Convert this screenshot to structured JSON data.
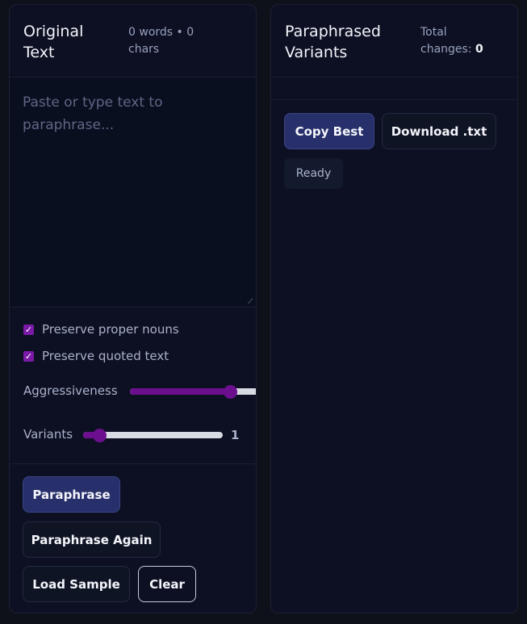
{
  "original": {
    "title": "Original Text",
    "word_count": "0",
    "words_label": "words",
    "separator": "•",
    "char_count": "0",
    "chars_label": "chars",
    "placeholder": "Paste or type text to paraphrase...",
    "preserve_proper_nouns_label": "Preserve proper nouns",
    "preserve_quoted_text_label": "Preserve quoted text",
    "aggressiveness_label": "Aggressiveness",
    "aggressiveness_level": 0.73,
    "variants_label": "Variants",
    "variants_value": "1",
    "variants_level": 0.12,
    "buttons": {
      "paraphrase": "Paraphrase",
      "paraphrase_again": "Paraphrase Again",
      "load_sample": "Load Sample",
      "clear": "Clear"
    }
  },
  "variants": {
    "title": "Paraphrased Variants",
    "total_changes_label": "Total changes:",
    "total_changes_value": "0",
    "copy_best": "Copy Best",
    "download": "Download .txt",
    "status": "Ready"
  },
  "colors": {
    "accent": "#6c0f8f",
    "primary_button": "#27306a",
    "background": "#0f111a",
    "panel": "#0c1022"
  }
}
